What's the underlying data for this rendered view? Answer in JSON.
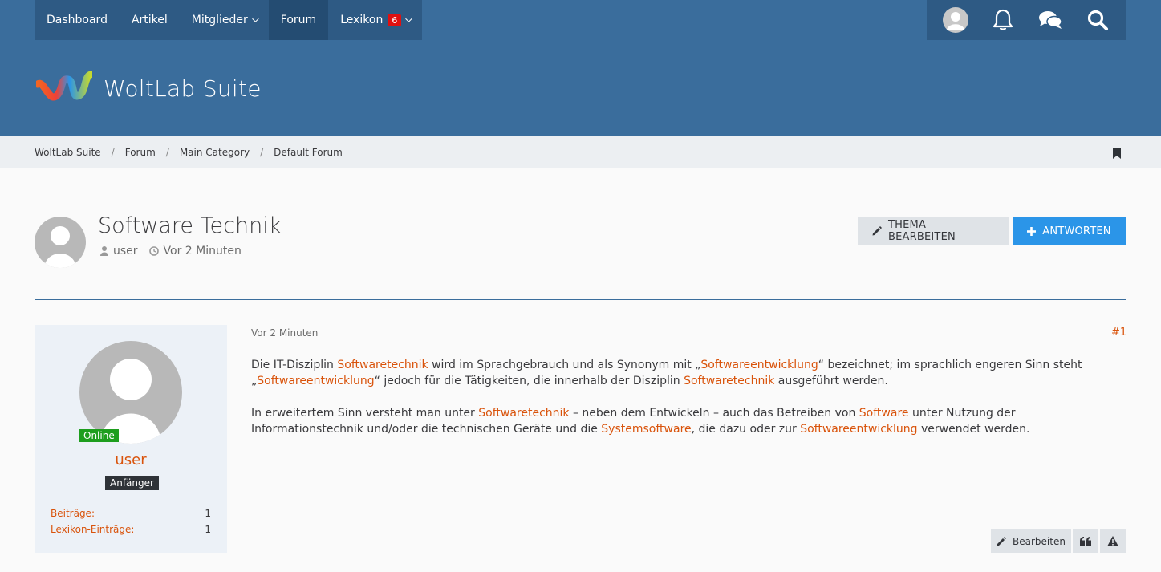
{
  "nav": {
    "items": [
      {
        "label": "Dashboard"
      },
      {
        "label": "Artikel"
      },
      {
        "label": "Mitglieder"
      },
      {
        "label": "Forum"
      },
      {
        "label": "Lexikon",
        "badge": "6"
      }
    ],
    "user_icons": [
      "avatar-icon",
      "bell-icon",
      "chat-icon",
      "search-icon"
    ]
  },
  "header": {
    "logo_text": "WoltLab Suite"
  },
  "breadcrumb": [
    "WoltLab Suite",
    "Forum",
    "Main Category",
    "Default Forum"
  ],
  "thread": {
    "title": "Software Technik",
    "author": "user",
    "time": "Vor 2 Minuten",
    "edit_button": "THEMA BEARBEITEN",
    "reply_button": "ANTWORTEN"
  },
  "post": {
    "time": "Vor 2 Minuten",
    "number": "#1",
    "author": {
      "name": "user",
      "status": "Online",
      "rank": "Anfänger",
      "stats": [
        {
          "label": "Beiträge:",
          "value": "1"
        },
        {
          "label": "Lexikon-Einträge:",
          "value": "1"
        }
      ]
    },
    "p1": {
      "t1": "Die IT-Disziplin ",
      "l1": "Softwaretechnik",
      "t2": " wird im Sprachgebrauch und als Synonym mit „",
      "l2": "Softwareentwicklung",
      "t3": "“ bezeichnet; im sprachlich engeren Sinn steht „",
      "l3": "Softwareentwicklung",
      "t4": "“ jedoch für die Tätigkeiten, die innerhalb der Disziplin ",
      "l4": "Softwaretechnik",
      "t5": " ausgeführt werden."
    },
    "p2": {
      "t1": "In erweitertem Sinn versteht man unter ",
      "l1": "Softwaretechnik",
      "t2": " – neben dem Entwickeln – auch das Betreiben von ",
      "l2": "Software",
      "t3": " unter Nutzung der Informationstechnik und/oder die technischen Geräte und die ",
      "l3": "Systemsoftware",
      "t4": ", die dazu oder zur ",
      "l4": "Softwareentwicklung",
      "t5": " verwendet werden."
    },
    "actions": {
      "edit": "Bearbeiten"
    }
  },
  "colors": {
    "nav_bg": "#2e5a84",
    "header_bg": "#3a6d9c",
    "link": "#d9530b",
    "reply_button": "#2b95e8",
    "online": "#1e9e1e"
  }
}
